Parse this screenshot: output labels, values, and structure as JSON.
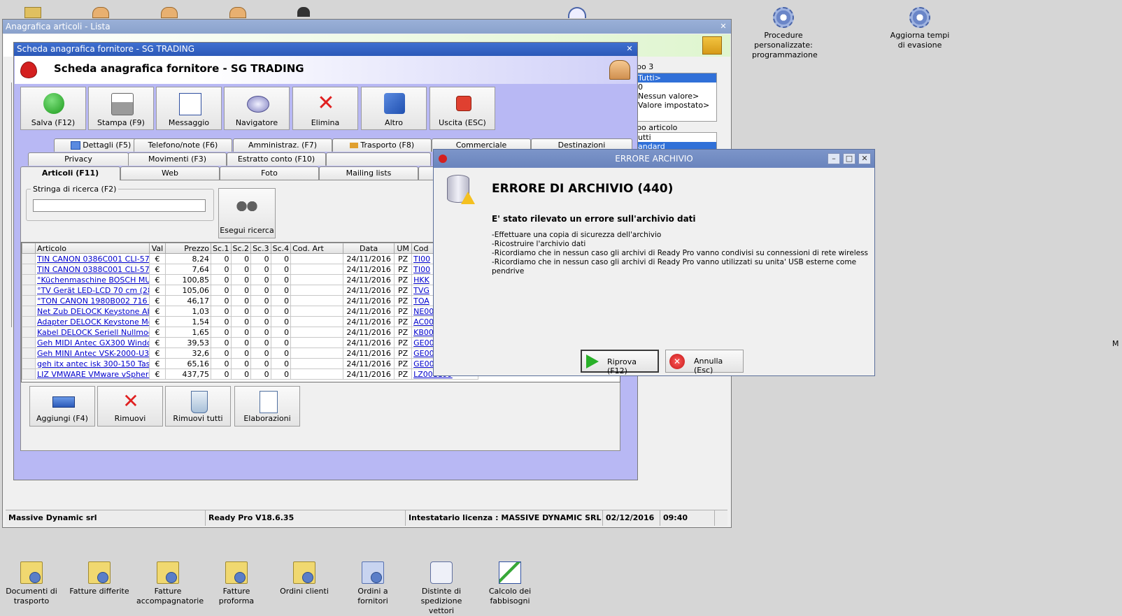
{
  "desktop_bottom_icons": [
    {
      "label": "Documenti di trasporto"
    },
    {
      "label": "Fatture differite"
    },
    {
      "label": "Fatture accompagnatorie"
    },
    {
      "label": "Fatture proforma"
    },
    {
      "label": "Ordini clienti"
    },
    {
      "label": "Ordini a fornitori"
    },
    {
      "label": "Distinte di spedizione vettori"
    },
    {
      "label": "Calcolo dei fabbisogni"
    }
  ],
  "desktop_right_icons": [
    {
      "label": "Procedure personalizzate: programmazione"
    },
    {
      "label": "Aggiorna tempi di evasione"
    }
  ],
  "main_window": {
    "title": "Anagrafica articoli  - Lista",
    "filter_group_3_label": "po 3",
    "filter_group_3_items": [
      "Tutti>",
      "0",
      "Nessun valore>",
      "Valore impostato>"
    ],
    "filter_tipo_label": "po articolo",
    "filter_tipo_items": [
      "utti",
      "andard"
    ]
  },
  "status_bar": {
    "company": "Massive Dynamic srl",
    "version": "Ready Pro V18.6.35",
    "license": "Intestatario licenza : MASSIVE DYNAMIC SRL",
    "date": "02/12/2016",
    "time": "09:40"
  },
  "supplier_window": {
    "title": "Scheda anagrafica fornitore - SG TRADING",
    "header": "Scheda anagrafica fornitore - SG TRADING",
    "toolbar": {
      "save": "Salva (F12)",
      "print": "Stampa (F9)",
      "message": "Messaggio",
      "navigator": "Navigatore",
      "delete": "Elimina",
      "other": "Altro",
      "exit": "Uscita (ESC)"
    },
    "tabs_row1": [
      "Dettagli (F5)",
      "Telefono/note (F6)",
      "Amministraz. (F7)",
      "Trasporto (F8)",
      "Commerciale",
      "Destinazioni"
    ],
    "tabs_row2": [
      "Privacy",
      "Movimenti (F3)",
      "Estratto conto (F10)"
    ],
    "tabs_row3": [
      "Articoli (F11)",
      "Web",
      "Foto",
      "Mailing lists"
    ],
    "search": {
      "label": "Stringa di ricerca (F2)",
      "value": "",
      "button": "Esegui ricerca"
    },
    "table": {
      "columns": [
        "Articolo",
        "Val",
        "Prezzo",
        "Sc.1",
        "Sc.2",
        "Sc.3",
        "Sc.4",
        "Cod. Art",
        "Data",
        "UM",
        "Cod"
      ],
      "rows": [
        [
          "TIN CANON 0386C001 CLI-571...",
          "€",
          "8,24",
          "0",
          "0",
          "0",
          "0",
          "",
          "24/11/2016",
          "PZ",
          "TI00"
        ],
        [
          "TIN CANON 0388C001 CLI-571...",
          "€",
          "7,64",
          "0",
          "0",
          "0",
          "0",
          "",
          "24/11/2016",
          "PZ",
          "TI00"
        ],
        [
          "°Küchenmaschine BOSCH MUM...",
          "€",
          "100,85",
          "0",
          "0",
          "0",
          "0",
          "",
          "24/11/2016",
          "PZ",
          "HKK"
        ],
        [
          "°TV Gerät LED-LCD 70 cm (28\")...",
          "€",
          "105,06",
          "0",
          "0",
          "0",
          "0",
          "",
          "24/11/2016",
          "PZ",
          "TVG"
        ],
        [
          "°TON CANON 1980B002 716 C...",
          "€",
          "46,17",
          "0",
          "0",
          "0",
          "0",
          "",
          "24/11/2016",
          "PZ",
          "TOA"
        ],
        [
          "Net Zub DELOCK Keystone Ab...",
          "€",
          "1,03",
          "0",
          "0",
          "0",
          "0",
          "",
          "24/11/2016",
          "PZ",
          "NE00"
        ],
        [
          "Adapter DELOCK Keystone Mo...",
          "€",
          "1,54",
          "0",
          "0",
          "0",
          "0",
          "",
          "24/11/2016",
          "PZ",
          "AC00"
        ],
        [
          "Kabel DELOCK Seriell Nullmode...",
          "€",
          "1,65",
          "0",
          "0",
          "0",
          "0",
          "",
          "24/11/2016",
          "PZ",
          "KB00"
        ],
        [
          "Geh MIDI Antec GX300 Windo...",
          "€",
          "39,53",
          "0",
          "0",
          "0",
          "0",
          "",
          "24/11/2016",
          "PZ",
          "GE00"
        ],
        [
          "Geh MINI Antec VSK-2000-U3 ...",
          "€",
          "32,6",
          "0",
          "0",
          "0",
          "0",
          "",
          "24/11/2016",
          "PZ",
          "GE00"
        ],
        [
          "geh itx antec isk 300-150 Tasti...",
          "€",
          "65,16",
          "0",
          "0",
          "0",
          "0",
          "",
          "24/11/2016",
          "PZ",
          "GE00"
        ],
        [
          "LIZ VMWARE VMware vSphere...",
          "€",
          "437,75",
          "0",
          "0",
          "0",
          "0",
          "",
          "24/11/2016",
          "PZ",
          "LZ001199"
        ]
      ]
    },
    "bottom_buttons": {
      "add": "Aggiungi (F4)",
      "remove": "Rimuovi",
      "remove_all": "Rimuovi tutti",
      "process": "Elaborazioni"
    }
  },
  "error_dialog": {
    "title": "ERRORE ARCHIVIO",
    "heading": "ERRORE DI ARCHIVIO (440)",
    "subheading": "E' stato rilevato un errore sull'archivio dati",
    "lines": [
      "-Effettuare una copia di sicurezza dell'archivio",
      "-Ricostruire l'archivio dati",
      "-Ricordiamo che in nessun caso gli archivi di Ready Pro vanno condivisi su connessioni di rete wireless",
      "-Ricordiamo che in nessun caso gli archivi di Ready Pro vanno utilizzati su unita' USB esterne come pendrive"
    ],
    "retry_button": "Riprova (F12)",
    "cancel_button": "Annulla (Esc)"
  },
  "edge_text": "M"
}
